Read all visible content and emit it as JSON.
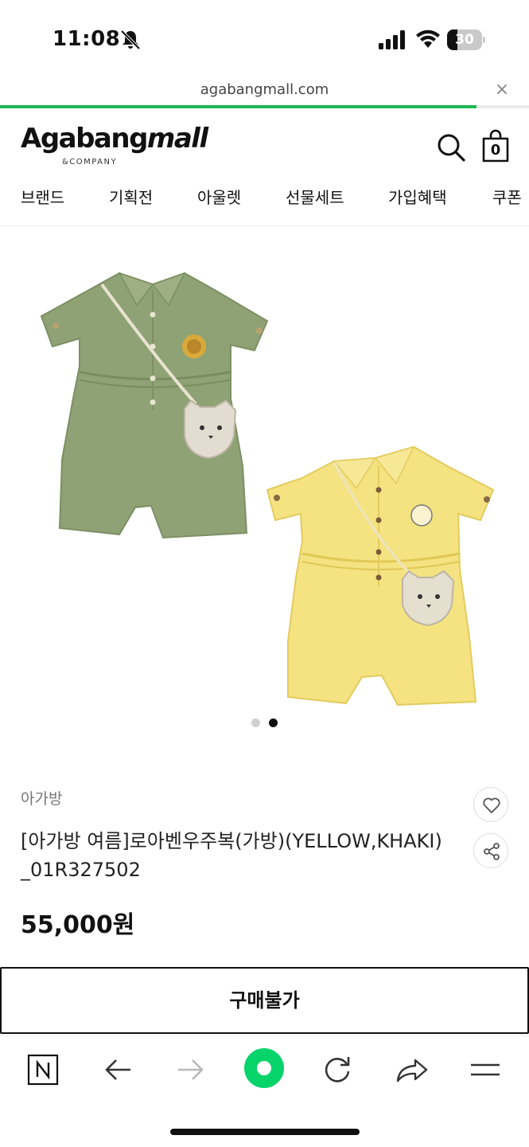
{
  "status_bar": {
    "time": "11:08",
    "battery_percent": "30",
    "battery_level": 0.3,
    "icons": [
      "bell-slash-icon",
      "signal-icon",
      "wifi-icon",
      "battery-icon"
    ]
  },
  "browser": {
    "url": "agabangmall.com",
    "close_label": "×",
    "load_progress": 0.9,
    "accent_color": "#1db954"
  },
  "header": {
    "logo_main": "Agabang",
    "logo_accent": "mall",
    "logo_sub": "&COMPANY",
    "cart_count": "0",
    "icons": [
      "search-icon",
      "shopping-bag-icon"
    ]
  },
  "nav": {
    "items": [
      {
        "label": "브랜드"
      },
      {
        "label": "기획전"
      },
      {
        "label": "아울렛"
      },
      {
        "label": "선물세트"
      },
      {
        "label": "가입혜택"
      },
      {
        "label": "쿠폰"
      }
    ]
  },
  "gallery": {
    "slide_count": 2,
    "active_slide": 2,
    "images": [
      "khaki-romper-with-bag",
      "yellow-romper-with-bag"
    ]
  },
  "product": {
    "brand": "아가방",
    "name": "[아가방 여름]로아벤우주복(가방)(YELLOW,KHAKI)_01R327502",
    "price": "55,000원",
    "buy_label": "구매불가",
    "icons": [
      "heart-icon",
      "share-icon"
    ]
  },
  "toolbar": {
    "icons": [
      "naver-n-icon",
      "back-arrow-icon",
      "forward-arrow-icon",
      "green-dot-icon",
      "refresh-icon",
      "share-arrow-icon",
      "menu-icon"
    ]
  }
}
